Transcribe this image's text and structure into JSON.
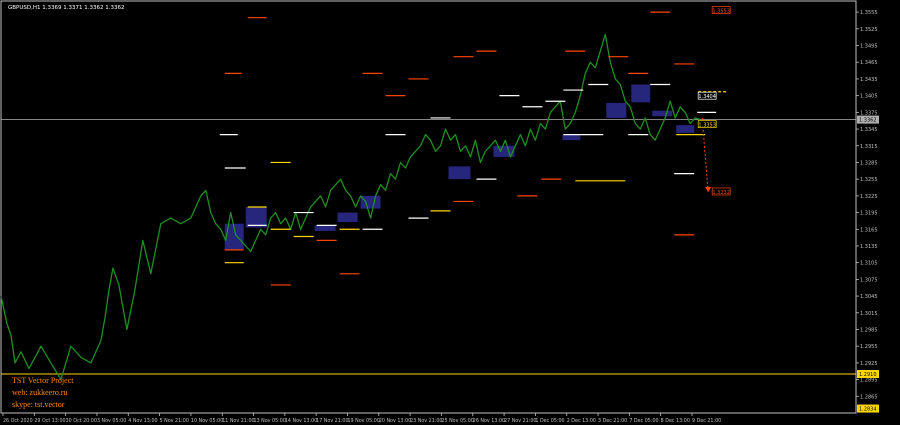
{
  "chart_data": {
    "type": "line",
    "title": "GBPUSD,H1  1.3369 1.3371 1.3362 1.3362",
    "symbol": "GBPUSD",
    "timeframe": "H1",
    "ohlc": {
      "open": 1.3369,
      "high": 1.3371,
      "low": 1.3362,
      "close": 1.3362
    },
    "ylim": [
      1.2835,
      1.3575
    ],
    "y_ticks": [
      1.3555,
      1.3525,
      1.3495,
      1.3465,
      1.3435,
      1.3405,
      1.3375,
      1.3345,
      1.3315,
      1.3285,
      1.3255,
      1.3225,
      1.3195,
      1.3165,
      1.3135,
      1.3105,
      1.3075,
      1.3045,
      1.3015,
      1.2985,
      1.2955,
      1.2925,
      1.2895,
      1.2865
    ],
    "x_tick_labels": [
      "26 Oct 2020",
      "29 Oct 13:00",
      "30 Oct 20:00",
      "3 Nov 05:00",
      "4 Nov 13:00",
      "5 Nov 21:00",
      "10 Nov 05:00",
      "11 Nov 21:00",
      "13 Nov 05:00",
      "14 Nov 13:00",
      "17 Nov 21:00",
      "19 Nov 05:00",
      "20 Nov 13:00",
      "23 Nov 21:00",
      "25 Nov 05:00",
      "26 Nov 13:00",
      "27 Nov 21:00",
      "1 Dec 05:00",
      "2 Dec 13:00",
      "3 Dec 21:00",
      "7 Dec 05:00",
      "8 Dec 13:00",
      "9 Dec 21:00"
    ],
    "price_series": {
      "name": "GBPUSD H1 close",
      "color": "#1f8f1f",
      "x": [
        0,
        6,
        10,
        14,
        20,
        28,
        40,
        50,
        60,
        70,
        80,
        90,
        100,
        104,
        108,
        112,
        118,
        126,
        134,
        142,
        150,
        160,
        170,
        180,
        190,
        200,
        205,
        210,
        215,
        220,
        225,
        230,
        235,
        240,
        245,
        250,
        255,
        260,
        265,
        270,
        275,
        280,
        285,
        290,
        295,
        300,
        305,
        310,
        315,
        320,
        325,
        330,
        335,
        340,
        345,
        350,
        355,
        360,
        365,
        370,
        375,
        380,
        385,
        390,
        395,
        400,
        405,
        410,
        415,
        420,
        425,
        430,
        435,
        440,
        445,
        450,
        455,
        460,
        465,
        470,
        475,
        480,
        485,
        490,
        495,
        500,
        505,
        510,
        515,
        520,
        525,
        530,
        535,
        540,
        545,
        550,
        555,
        560,
        565,
        570,
        575,
        580,
        585,
        590,
        595,
        600,
        605,
        610,
        615,
        620,
        625,
        630,
        635,
        640,
        645,
        650,
        655,
        660,
        665,
        670,
        675,
        680,
        685,
        690,
        695,
        700
      ],
      "y": [
        1.3045,
        1.2995,
        1.2975,
        1.2925,
        1.2945,
        1.2915,
        1.2955,
        1.2925,
        1.2895,
        1.2955,
        1.2935,
        1.2925,
        1.2965,
        1.3005,
        1.3055,
        1.3095,
        1.3065,
        1.2985,
        1.3055,
        1.3145,
        1.3085,
        1.3175,
        1.3185,
        1.3175,
        1.3185,
        1.3225,
        1.3235,
        1.3195,
        1.3175,
        1.3165,
        1.3145,
        1.3195,
        1.3155,
        1.3145,
        1.3135,
        1.3125,
        1.3145,
        1.3165,
        1.3155,
        1.3185,
        1.3195,
        1.3175,
        1.3185,
        1.3165,
        1.3195,
        1.3165,
        1.3185,
        1.3205,
        1.3215,
        1.3225,
        1.3205,
        1.3235,
        1.3245,
        1.3255,
        1.3235,
        1.3225,
        1.3205,
        1.3225,
        1.3215,
        1.3185,
        1.3225,
        1.3245,
        1.3235,
        1.3265,
        1.3255,
        1.3285,
        1.3275,
        1.3295,
        1.3305,
        1.3315,
        1.3335,
        1.3325,
        1.3305,
        1.3315,
        1.3345,
        1.3325,
        1.3335,
        1.3305,
        1.3315,
        1.3295,
        1.3325,
        1.3285,
        1.3305,
        1.3315,
        1.3325,
        1.3305,
        1.3325,
        1.3295,
        1.3315,
        1.3335,
        1.3315,
        1.3345,
        1.3325,
        1.3355,
        1.3345,
        1.3375,
        1.3385,
        1.3395,
        1.3345,
        1.3355,
        1.3375,
        1.3405,
        1.3445,
        1.3465,
        1.3455,
        1.3485,
        1.3515,
        1.3465,
        1.3435,
        1.3425,
        1.3395,
        1.3385,
        1.3355,
        1.3345,
        1.3365,
        1.3335,
        1.3325,
        1.3345,
        1.3365,
        1.3395,
        1.3365,
        1.3385,
        1.3375,
        1.3355,
        1.3365,
        1.3362
      ]
    },
    "boxes": [
      {
        "x0": 224,
        "x1": 243,
        "y0": 1.3128,
        "y1": 1.3175,
        "color": "#2a2a8a"
      },
      {
        "x0": 245,
        "x1": 266,
        "y0": 1.3168,
        "y1": 1.3205,
        "color": "#2a2a8a"
      },
      {
        "x0": 314,
        "x1": 335,
        "y0": 1.3162,
        "y1": 1.3172,
        "color": "#2a2a8a"
      },
      {
        "x0": 337,
        "x1": 357,
        "y0": 1.3178,
        "y1": 1.3195,
        "color": "#2a2a8a"
      },
      {
        "x0": 360,
        "x1": 380,
        "y0": 1.3202,
        "y1": 1.3225,
        "color": "#2a2a8a"
      },
      {
        "x0": 448,
        "x1": 470,
        "y0": 1.3255,
        "y1": 1.3278,
        "color": "#2a2a8a"
      },
      {
        "x0": 493,
        "x1": 514,
        "y0": 1.3295,
        "y1": 1.3315,
        "color": "#2a2a8a"
      },
      {
        "x0": 562,
        "x1": 580,
        "y0": 1.3325,
        "y1": 1.3335,
        "color": "#2a2a8a"
      },
      {
        "x0": 606,
        "x1": 626,
        "y0": 1.3365,
        "y1": 1.3392,
        "color": "#2a2a8a"
      },
      {
        "x0": 631,
        "x1": 650,
        "y0": 1.3393,
        "y1": 1.3425,
        "color": "#2a2a8a"
      },
      {
        "x0": 652,
        "x1": 672,
        "y0": 1.3368,
        "y1": 1.3378,
        "color": "#2a2a8a"
      },
      {
        "x0": 676,
        "x1": 694,
        "y0": 1.3338,
        "y1": 1.3352,
        "color": "#2a2a8a"
      }
    ],
    "levels": [
      {
        "x0": 224,
        "x1": 241,
        "y": 1.3445,
        "color": "#ff4500"
      },
      {
        "x0": 224,
        "x1": 243,
        "y": 1.3128,
        "color": "#ff4500"
      },
      {
        "x0": 224,
        "x1": 243,
        "y": 1.3105,
        "color": "#ffd700"
      },
      {
        "x0": 224,
        "x1": 245,
        "y": 1.3275,
        "color": "#ffffff"
      },
      {
        "x0": 219,
        "x1": 237,
        "y": 1.3335,
        "color": "#ffffff"
      },
      {
        "x0": 247,
        "x1": 266,
        "y": 1.3545,
        "color": "#ff4500"
      },
      {
        "x0": 247,
        "x1": 266,
        "y": 1.3205,
        "color": "#ffd700"
      },
      {
        "x0": 247,
        "x1": 266,
        "y": 1.3172,
        "color": "#ffffff"
      },
      {
        "x0": 270,
        "x1": 290,
        "y": 1.3285,
        "color": "#ffd700"
      },
      {
        "x0": 270,
        "x1": 290,
        "y": 1.3165,
        "color": "#ffd700"
      },
      {
        "x0": 270,
        "x1": 290,
        "y": 1.3065,
        "color": "#ff4500"
      },
      {
        "x0": 293,
        "x1": 313,
        "y": 1.3195,
        "color": "#ffffff"
      },
      {
        "x0": 293,
        "x1": 313,
        "y": 1.3152,
        "color": "#ffd700"
      },
      {
        "x0": 316,
        "x1": 336,
        "y": 1.3172,
        "color": "#ffffff"
      },
      {
        "x0": 316,
        "x1": 336,
        "y": 1.3145,
        "color": "#ff4500"
      },
      {
        "x0": 339,
        "x1": 359,
        "y": 1.3085,
        "color": "#ff4500"
      },
      {
        "x0": 339,
        "x1": 359,
        "y": 1.3165,
        "color": "#ffd700"
      },
      {
        "x0": 362,
        "x1": 382,
        "y": 1.3445,
        "color": "#ff4500"
      },
      {
        "x0": 362,
        "x1": 382,
        "y": 1.3165,
        "color": "#ffffff"
      },
      {
        "x0": 385,
        "x1": 405,
        "y": 1.3405,
        "color": "#ff4500"
      },
      {
        "x0": 385,
        "x1": 405,
        "y": 1.3335,
        "color": "#ffffff"
      },
      {
        "x0": 408,
        "x1": 428,
        "y": 1.3435,
        "color": "#ff4500"
      },
      {
        "x0": 408,
        "x1": 428,
        "y": 1.3185,
        "color": "#ffffff"
      },
      {
        "x0": 430,
        "x1": 450,
        "y": 1.3365,
        "color": "#ffffff"
      },
      {
        "x0": 430,
        "x1": 450,
        "y": 1.3198,
        "color": "#ffd700"
      },
      {
        "x0": 453,
        "x1": 473,
        "y": 1.3475,
        "color": "#ff4500"
      },
      {
        "x0": 453,
        "x1": 473,
        "y": 1.3215,
        "color": "#ff4500"
      },
      {
        "x0": 476,
        "x1": 496,
        "y": 1.3485,
        "color": "#ff4500"
      },
      {
        "x0": 476,
        "x1": 496,
        "y": 1.3255,
        "color": "#ffffff"
      },
      {
        "x0": 499,
        "x1": 519,
        "y": 1.3405,
        "color": "#ffffff"
      },
      {
        "x0": 517,
        "x1": 537,
        "y": 1.3225,
        "color": "#ff4500"
      },
      {
        "x0": 522,
        "x1": 542,
        "y": 1.3385,
        "color": "#ffffff"
      },
      {
        "x0": 541,
        "x1": 561,
        "y": 1.3255,
        "color": "#ff4500"
      },
      {
        "x0": 545,
        "x1": 565,
        "y": 1.3395,
        "color": "#ffffff"
      },
      {
        "x0": 565,
        "x1": 585,
        "y": 1.3485,
        "color": "#ff4500"
      },
      {
        "x0": 563,
        "x1": 583,
        "y": 1.3415,
        "color": "#ffffff"
      },
      {
        "x0": 563,
        "x1": 603,
        "y": 1.3335,
        "color": "#ffffff"
      },
      {
        "x0": 575,
        "x1": 625,
        "y": 1.3252,
        "color": "#ffd700"
      },
      {
        "x0": 588,
        "x1": 608,
        "y": 1.3425,
        "color": "#ffffff"
      },
      {
        "x0": 608,
        "x1": 628,
        "y": 1.3475,
        "color": "#ff4500"
      },
      {
        "x0": 628,
        "x1": 648,
        "y": 1.3445,
        "color": "#ff4500"
      },
      {
        "x0": 628,
        "x1": 648,
        "y": 1.3335,
        "color": "#ffffff"
      },
      {
        "x0": 650,
        "x1": 670,
        "y": 1.3425,
        "color": "#ffffff"
      },
      {
        "x0": 650,
        "x1": 670,
        "y": 1.3555,
        "color": "#ff4500"
      },
      {
        "x0": 674,
        "x1": 694,
        "y": 1.3462,
        "color": "#ff4500"
      },
      {
        "x0": 674,
        "x1": 694,
        "y": 1.3265,
        "color": "#ffffff"
      },
      {
        "x0": 674,
        "x1": 694,
        "y": 1.3155,
        "color": "#ff4500"
      },
      {
        "x0": 697,
        "x1": 716,
        "y": 1.3375,
        "color": "#ffffff"
      },
      {
        "x0": 676,
        "x1": 705,
        "y": 1.3335,
        "color": "#ffd700"
      }
    ],
    "projection": {
      "x0": 698,
      "x1": 728,
      "y": 1.3412,
      "color": "#ffd700",
      "arrow": {
        "x0": 702,
        "y0": 1.3365,
        "x1": 708,
        "y1": 1.3232,
        "color": "#ff4500"
      }
    },
    "bid_line": {
      "y": 1.3362,
      "color": "#b0b0b0"
    },
    "support_line": {
      "y": 1.2905,
      "color": "#ffd700"
    },
    "right_labels": [
      {
        "text": "1.3553",
        "y": 1.3558,
        "color": "#ff4500",
        "x": 712
      },
      {
        "text": "1.3404",
        "y": 1.3404,
        "color": "#ffffff",
        "x": 698
      },
      {
        "text": "1.3353",
        "y": 1.3353,
        "color": "#ffd700",
        "x": 698
      },
      {
        "text": "1.3232",
        "y": 1.3232,
        "color": "#ff4500",
        "x": 712
      }
    ],
    "axis_price_tags": [
      {
        "text": "1.3362",
        "y": 1.3362,
        "fg": "#000000",
        "bg": "#b0b0b0"
      },
      {
        "text": "1.2910",
        "y": 1.2905,
        "fg": "#000000",
        "bg": "#ffd700"
      },
      {
        "text": "1.2834",
        "y": 1.2843,
        "fg": "#000000",
        "bg": "#ffd700"
      }
    ]
  },
  "info_panel": {
    "line1": "TST Vector Project",
    "line2": "web: zukkeero.ru",
    "line3": "skype: tst.vector"
  }
}
